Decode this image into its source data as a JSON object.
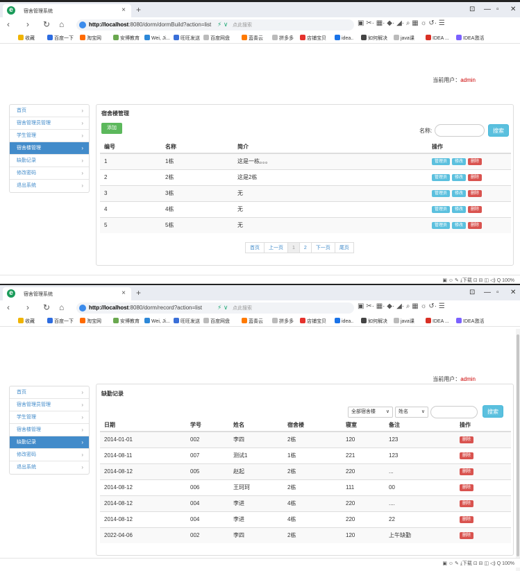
{
  "colors": {
    "accent": "#428bca",
    "success": "#5cb85c",
    "info": "#5bc0de",
    "danger": "#d9534f",
    "brand": "#1a9b5a"
  },
  "browser": {
    "tab_title": "宿舍管理系统",
    "tab_close": "×",
    "new_tab": "+",
    "search_placeholder": "点此搜索",
    "toolbar_icons": "▣ ✂· ▦· ◆· ◢· ⌕ ▦ ☼ ↺· ☰",
    "status": "▣ ☺ ✎ ⤓下载 ⊡ ⊟ ◫ ◁) Q 100%",
    "bookmarks": [
      "收藏",
      "百度一下",
      "淘宝网",
      "安博教育",
      "Wei, Ji...",
      "旺旺发送",
      "百度网盘",
      "蓝奏云",
      "拼多多",
      "店铺宝贝",
      "idea..",
      "如何解决",
      "java课",
      "IDEA ...",
      "IDEA激活"
    ]
  },
  "window1": {
    "url_host": "http://localhost",
    "url_rest": ":8080/dorm/dormBuild?action=list",
    "current_user_label": "当前用户：",
    "current_user": "admin",
    "panel_title": "宿舍楼管理",
    "add_button": "添加",
    "search_label": "名称:",
    "search_button": "搜索",
    "headers": [
      "编号",
      "名称",
      "简介",
      "操作"
    ],
    "rows": [
      {
        "id": "1",
        "name": "1栋",
        "desc": "这是一栋。。。"
      },
      {
        "id": "2",
        "name": "2栋",
        "desc": "这是2栋"
      },
      {
        "id": "3",
        "name": "3栋",
        "desc": "无"
      },
      {
        "id": "4",
        "name": "4栋",
        "desc": "无"
      },
      {
        "id": "5",
        "name": "5栋",
        "desc": "无"
      }
    ],
    "row_actions": [
      "管理员",
      "修改",
      "删除"
    ],
    "pager": [
      "首页",
      "上一页",
      "1",
      "2",
      "下一页",
      "尾页"
    ]
  },
  "window2": {
    "url_host": "http://localhost",
    "url_rest": ":8080/dorm/record?action=list",
    "current_user_label": "当前用户：",
    "current_user": "admin",
    "panel_title": "缺勤记录",
    "select_building": "全部宿舍楼",
    "select_field": "姓名",
    "search_button": "搜索",
    "headers": [
      "日期",
      "学号",
      "姓名",
      "宿舍楼",
      "寝室",
      "备注",
      "操作"
    ],
    "rows": [
      {
        "date": "2014-01-01",
        "sno": "002",
        "name": "李四",
        "build": "2栋",
        "room": "120",
        "note": "123"
      },
      {
        "date": "2014-08-11",
        "sno": "007",
        "name": "测试1",
        "build": "1栋",
        "room": "221",
        "note": "123"
      },
      {
        "date": "2014-08-12",
        "sno": "005",
        "name": "赵起",
        "build": "2栋",
        "room": "220",
        "note": "..."
      },
      {
        "date": "2014-08-12",
        "sno": "006",
        "name": "王珂珂",
        "build": "2栋",
        "room": "111",
        "note": "00"
      },
      {
        "date": "2014-08-12",
        "sno": "004",
        "name": "李进",
        "build": "4栋",
        "room": "220",
        "note": "...."
      },
      {
        "date": "2014-08-12",
        "sno": "004",
        "name": "李进",
        "build": "4栋",
        "room": "220",
        "note": "22"
      },
      {
        "date": "2022-04-06",
        "sno": "002",
        "name": "李四",
        "build": "2栋",
        "room": "120",
        "note": "上午缺勤"
      }
    ],
    "row_action": "删除"
  },
  "sidebar": {
    "items": [
      "首页",
      "宿舍管理员管理",
      "学生管理",
      "宿舍楼管理",
      "缺勤记录",
      "修改密码",
      "退出系统"
    ],
    "chevron": "›"
  }
}
